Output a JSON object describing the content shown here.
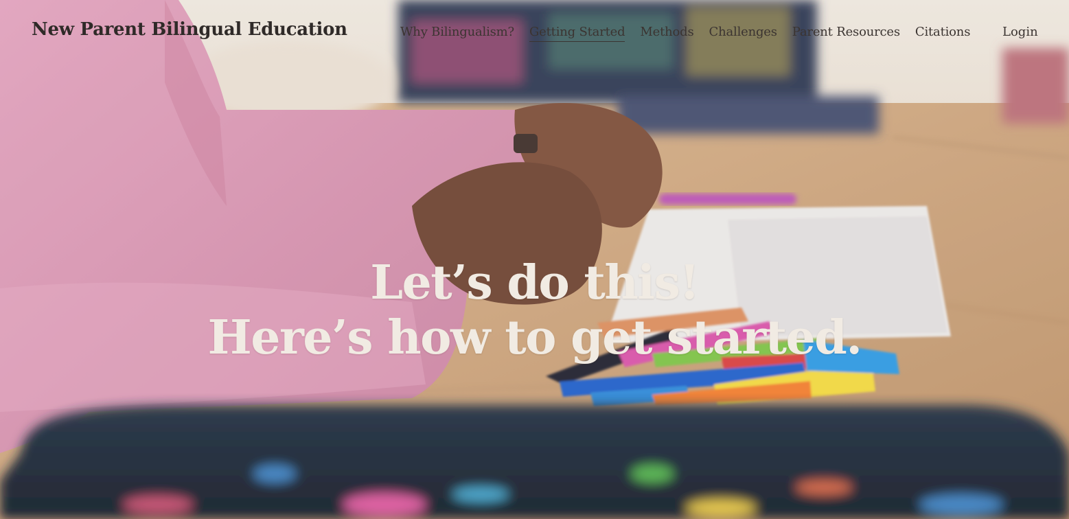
{
  "site": {
    "title": "New Parent Bilingual Education"
  },
  "nav": {
    "items": [
      {
        "label": "Why Bilingualism?",
        "active": false
      },
      {
        "label": "Getting Started",
        "active": true
      },
      {
        "label": "Methods",
        "active": false
      },
      {
        "label": "Challenges",
        "active": false
      },
      {
        "label": "Parent Resources",
        "active": false
      },
      {
        "label": "Citations",
        "active": false
      }
    ],
    "login_label": "Login"
  },
  "hero": {
    "headline_line1": "Let’s do this!",
    "headline_line2": "Here’s how to get started."
  },
  "colors": {
    "text_dark": "#3b3431",
    "headline": "#f1ebe3",
    "sweater_pink": "#d98aa8",
    "table_wood": "#c9a27a"
  }
}
